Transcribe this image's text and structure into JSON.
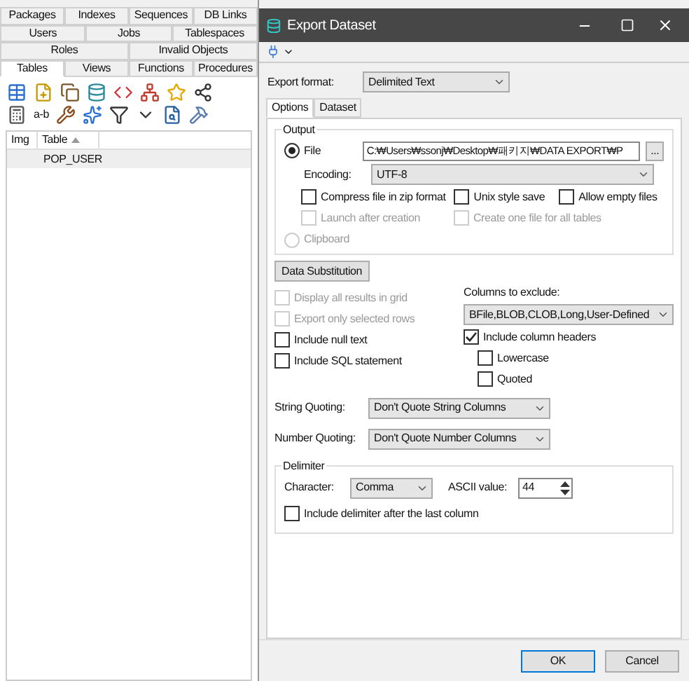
{
  "object_tabs": [
    [
      {
        "label": "Packages",
        "selected": false
      },
      {
        "label": "Indexes",
        "selected": false
      },
      {
        "label": "Sequences",
        "selected": false
      },
      {
        "label": "DB Links",
        "selected": false
      }
    ],
    [
      {
        "label": "Users",
        "selected": false
      },
      {
        "label": "Jobs",
        "selected": false
      },
      {
        "label": "Tablespaces",
        "selected": false
      }
    ],
    [
      {
        "label": "Roles",
        "selected": false
      },
      {
        "label": "Invalid Objects",
        "selected": false
      }
    ],
    [
      {
        "label": "Tables",
        "selected": true
      },
      {
        "label": "Views",
        "selected": false
      },
      {
        "label": "Functions",
        "selected": false
      },
      {
        "label": "Procedures",
        "selected": false
      }
    ]
  ],
  "toolbar_text": "a-b",
  "grid": {
    "columns": [
      "Img",
      "Table"
    ],
    "rows": [
      {
        "table": "POP_USER",
        "selected": true
      }
    ]
  },
  "dialog": {
    "title": "Export Dataset",
    "export_format": {
      "label": "Export format:",
      "value": "Delimited Text"
    },
    "tabs": [
      {
        "label": "Options",
        "selected": true
      },
      {
        "label": "Dataset",
        "selected": false
      }
    ],
    "output": {
      "title": "Output",
      "file": {
        "label": "File",
        "selected": true,
        "value": "C:₩Users₩ssonj₩Desktop₩패키지₩DATA EXPORT₩P",
        "browse": "..."
      },
      "encoding": {
        "label": "Encoding:",
        "value": "UTF-8"
      },
      "options": [
        {
          "label": "Compress file in zip format",
          "checked": false,
          "disabled": false
        },
        {
          "label": "Unix style save",
          "checked": false,
          "disabled": false
        },
        {
          "label": "Allow empty files",
          "checked": false,
          "disabled": false
        },
        {
          "label": "Launch after creation",
          "checked": false,
          "disabled": true
        },
        {
          "label": "Create one file for all tables",
          "checked": false,
          "disabled": true
        }
      ],
      "clipboard": {
        "label": "Clipboard",
        "selected": false,
        "disabled": true
      }
    },
    "data_substitution": "Data Substitution",
    "left_options": [
      {
        "label": "Display all results in grid",
        "checked": false,
        "disabled": true
      },
      {
        "label": "Export only selected rows",
        "checked": false,
        "disabled": true
      },
      {
        "label": "Include null text",
        "checked": false,
        "disabled": false
      },
      {
        "label": "Include SQL statement",
        "checked": false,
        "disabled": false
      }
    ],
    "columns_to_exclude": {
      "label": "Columns to exclude:",
      "value": "BFile,BLOB,CLOB,Long,User-Defined"
    },
    "include_headers": {
      "label": "Include column headers",
      "checked": true,
      "disabled": false,
      "children": [
        {
          "label": "Lowercase",
          "checked": false,
          "disabled": false
        },
        {
          "label": "Quoted",
          "checked": false,
          "disabled": false
        }
      ]
    },
    "string_quoting": {
      "label": "String Quoting:",
      "value": "Don't Quote String Columns"
    },
    "number_quoting": {
      "label": "Number Quoting:",
      "value": "Don't Quote Number Columns"
    },
    "delimiter": {
      "title": "Delimiter",
      "character": {
        "label": "Character:",
        "value": "Comma"
      },
      "ascii": {
        "label": "ASCII value:",
        "value": "44"
      },
      "option": {
        "label": "Include delimiter after the last column",
        "checked": false,
        "disabled": false
      }
    },
    "buttons": [
      {
        "label": "OK",
        "kind": "default"
      },
      {
        "label": "Cancel",
        "kind": "normal"
      }
    ]
  }
}
